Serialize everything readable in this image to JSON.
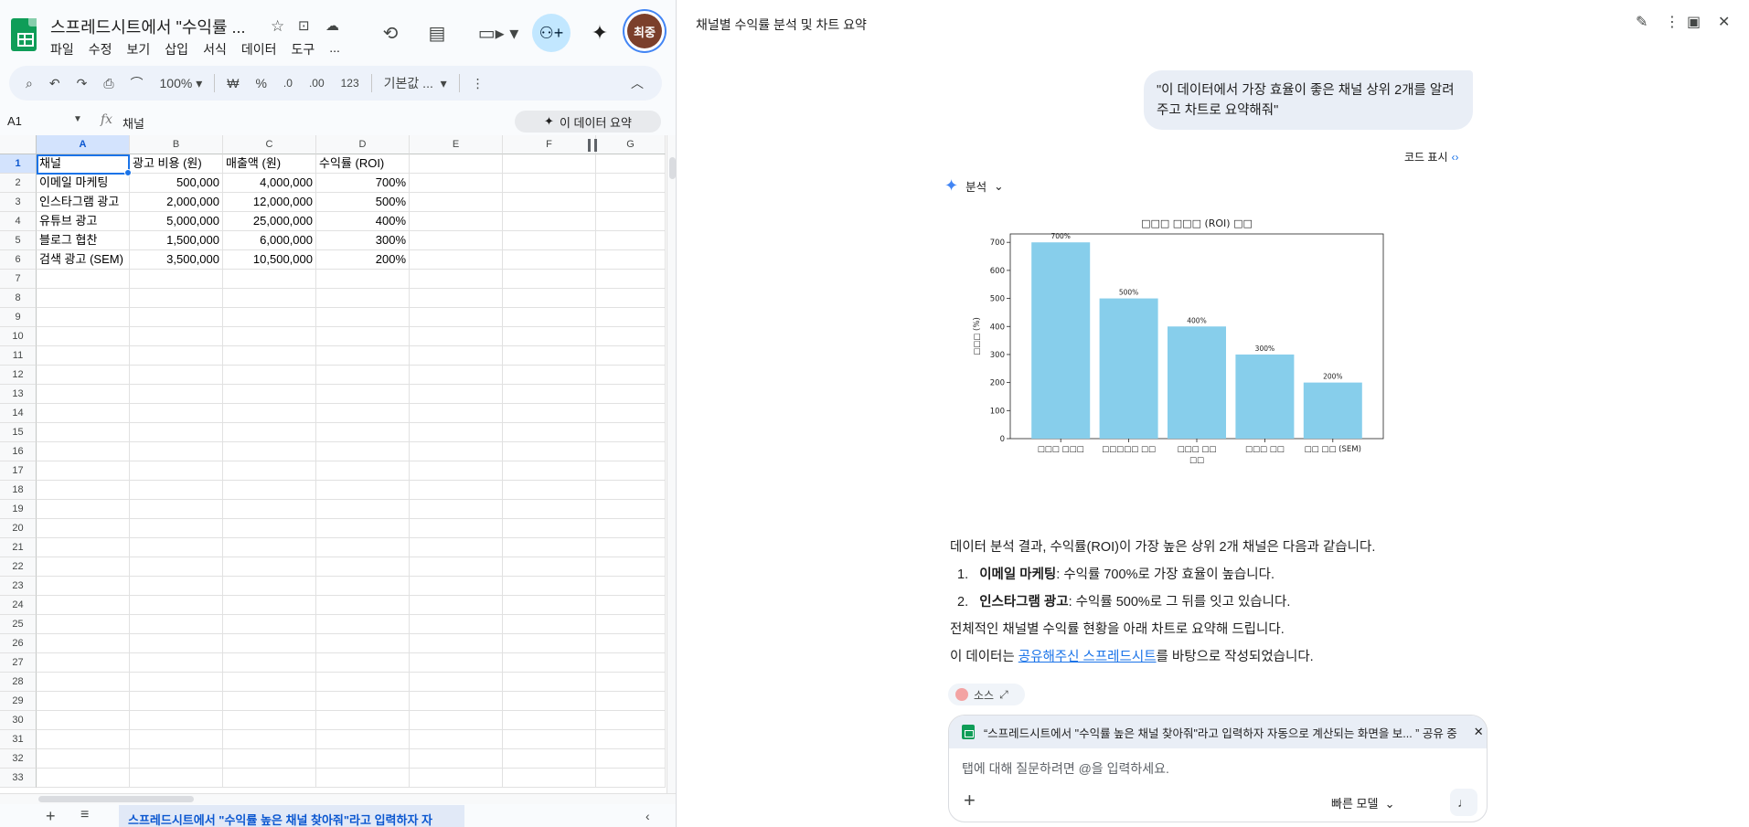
{
  "sheets": {
    "title": "스프레드시트에서 \"수익률 ...",
    "menu": [
      "파일",
      "수정",
      "보기",
      "삽입",
      "서식",
      "데이터",
      "도구",
      "..."
    ],
    "avatar_label": "최중",
    "toolbar": {
      "zoom": "100%",
      "currency": "₩",
      "percent": "%",
      "dec_decrease": ".0",
      "dec_increase": ".00",
      "number_format": "123",
      "font": "기본값 ..."
    },
    "formula_bar": {
      "name_box": "A1",
      "fx": "fx",
      "value": "채널"
    },
    "ai_summary_label": "이 데이터 요약",
    "columns": [
      "A",
      "B",
      "C",
      "D",
      "E",
      "F",
      "G"
    ],
    "row_count": 33,
    "table": [
      [
        "채널",
        "광고 비용 (원)",
        "매출액 (원)",
        "수익률 (ROI)"
      ],
      [
        "이메일 마케팅",
        "500,000",
        "4,000,000",
        "700%"
      ],
      [
        "인스타그램 광고",
        "2,000,000",
        "12,000,000",
        "500%"
      ],
      [
        "유튜브 광고",
        "5,000,000",
        "25,000,000",
        "400%"
      ],
      [
        "블로그 협찬",
        "1,500,000",
        "6,000,000",
        "300%"
      ],
      [
        "검색 광고 (SEM)",
        "3,500,000",
        "10,500,000",
        "200%"
      ]
    ],
    "sheet_tab": "스프레드시트에서 \"수익률 높은 채널 찾아줘\"라고 입력하자 자"
  },
  "panel": {
    "title": "채널별 수익률 분석 및 차트 요약",
    "user_prompt": "\"이 데이터에서 가장 효율이 좋은 채널 상위 2개를 알려주고 차트로 요약해줘\"",
    "code_show_label": "코드 표시",
    "analysis_label": "분석",
    "answer": {
      "intro": "데이터 분석 결과, 수익률(ROI)이 가장 높은 상위 2개 채널은 다음과 같습니다.",
      "item1_num": "1.",
      "item1_bold": "이메일 마케팅",
      "item1_rest": ": 수익률 700%로 가장 효율이 높습니다.",
      "item2_num": "2.",
      "item2_bold": "인스타그램 광고",
      "item2_rest": ": 수익률 500%로 그 뒤를 잇고 있습니다.",
      "summary": "전체적인 채널별 수익률 현황을 아래 차트로 요약해 드립니다.",
      "source_prefix": "이 데이터는 ",
      "source_link": "공유해주신 스프레드시트",
      "source_suffix": "를 바탕으로 작성되었습니다."
    },
    "source_chip": "소스",
    "context_chip": "“스프레드시트에서 \"수익률 높은 채널 찾아줘\"라고 입력하자 자동으로 계산되는 화면을 보... ” 공유 중",
    "input_placeholder": "탭에 대해 질문하려면 @을 입력하세요.",
    "model_label": "빠른 모델"
  },
  "chart_data": {
    "type": "bar",
    "title": "□□□ □□□ (ROI) □□",
    "ylabel": "□□□ (%)",
    "xlabel": "□□",
    "categories": [
      "□□□ □□□",
      "□□□□□ □□",
      "□□□ □□",
      "□□□ □□",
      "□□ □□ (SEM)"
    ],
    "values": [
      700,
      500,
      400,
      300,
      200
    ],
    "data_labels": [
      "700%",
      "500%",
      "400%",
      "300%",
      "200%"
    ],
    "ylim": [
      0,
      730
    ],
    "yticks": [
      0,
      100,
      200,
      300,
      400,
      500,
      600,
      700
    ],
    "bar_color": "#87ceeb"
  }
}
